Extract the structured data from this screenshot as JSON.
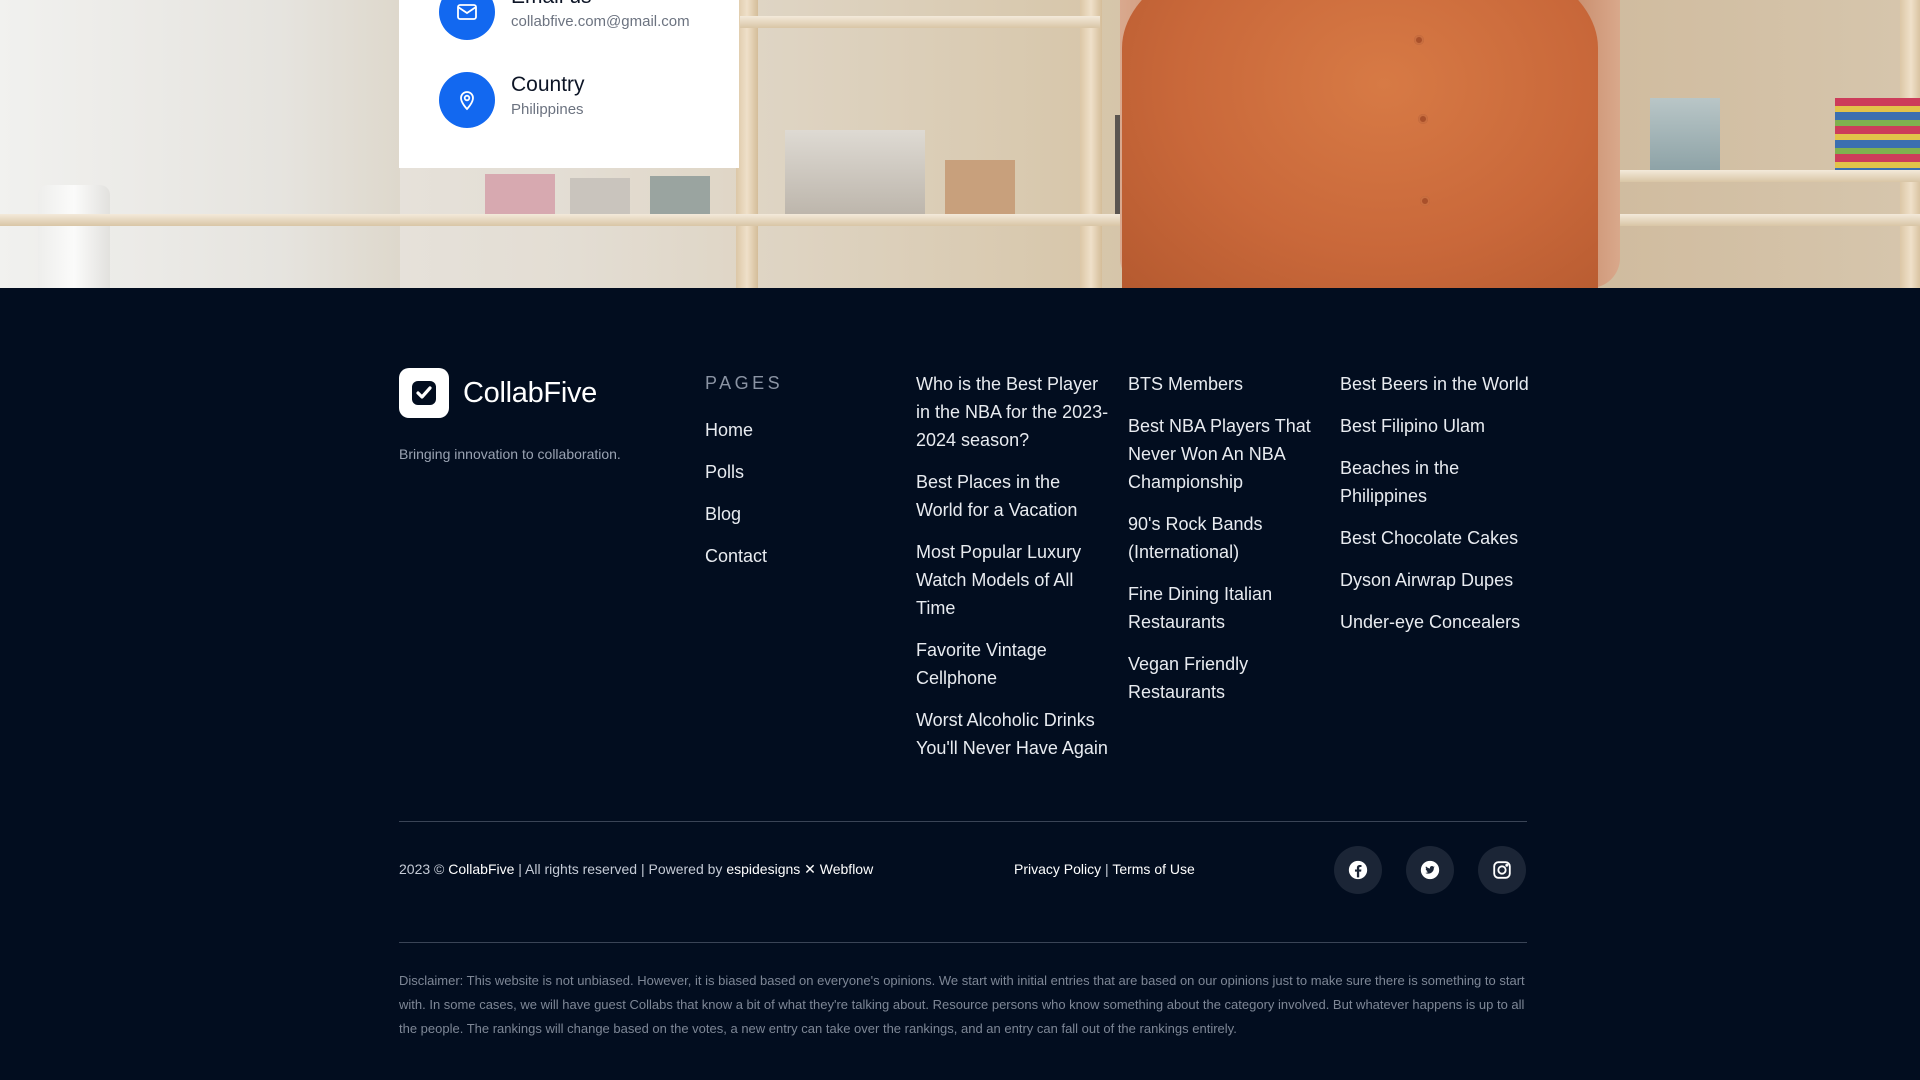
{
  "contact": {
    "email_title": "Email us",
    "email_value": "collabfive.com@gmail.com",
    "country_title": "Country",
    "country_value": "Philippines"
  },
  "brand": {
    "name": "CollabFive",
    "tagline": "Bringing innovation to collaboration."
  },
  "pages": {
    "heading": "PAGES",
    "links": [
      "Home",
      "Polls",
      "Blog",
      "Contact"
    ]
  },
  "col2": [
    "Who is the Best Player in the NBA for the 2023-2024 season?",
    "Best Places in the World for a Vacation",
    "Most Popular Luxury Watch Models of All Time",
    "Favorite Vintage Cellphone",
    "Worst Alcoholic Drinks You'll Never Have Again"
  ],
  "col3": [
    "BTS Members",
    "Best NBA Players That Never Won An NBA Championship",
    "90's Rock Bands (International)",
    "Fine Dining Italian Restaurants",
    "Vegan Friendly Restaurants"
  ],
  "col4": [
    "Best Beers in the World",
    "Best Filipino Ulam",
    "Beaches in the Philippines",
    "Best Chocolate Cakes",
    "Dyson Airwrap Dupes",
    "Under-eye Concealers"
  ],
  "bottom": {
    "copyright_prefix": "2023 ©",
    "copyright_brand": "CollabFive",
    "rights": "| All rights reserved | Powered by",
    "powered_by": "espidesigns ✕ Webflow",
    "privacy": "Privacy Policy",
    "separator": "|",
    "terms": "Terms of Use"
  },
  "social": {
    "icons": [
      "facebook-icon",
      "twitter-icon",
      "instagram-icon"
    ]
  },
  "disclaimer": "Disclaimer: This website is not unbiased. However, it is biased based on everyone's opinions. We start with initial entries that are based on our opinions just to make sure there is something to start with. In some cases, we will have guest Collabs that know a bit of what they're talking about. Resource persons who know something about the category involved. But whatever happens is up to all the people. The rankings will change based on the votes, a new entry can take over the rankings, and an entry can fall out of the rankings entirely.",
  "colors": {
    "footer_bg": "#020d1f",
    "accent_blue": "#1268f0",
    "shirt": "#c9683a"
  }
}
